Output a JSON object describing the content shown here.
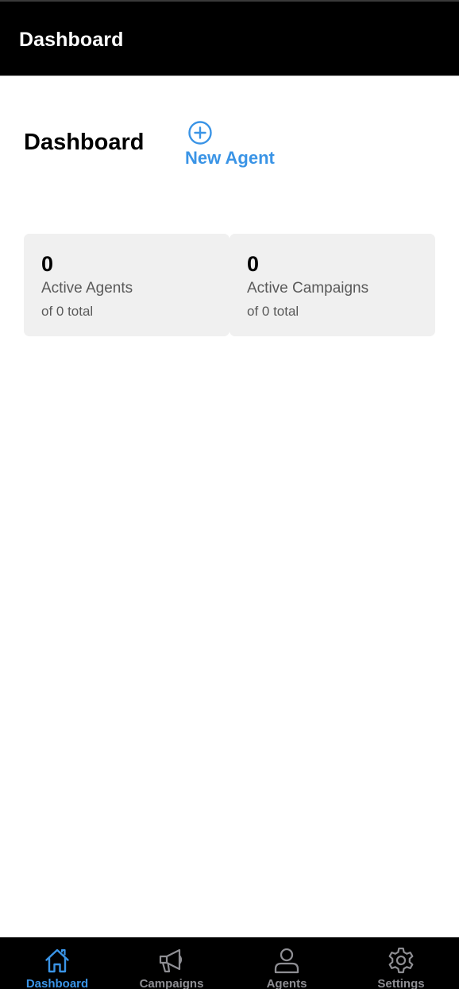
{
  "header": {
    "title": "Dashboard"
  },
  "main": {
    "heading": "Dashboard",
    "new_agent": {
      "label": "New Agent",
      "icon": "plus-circle-icon"
    },
    "stats": [
      {
        "count": "0",
        "label": "Active Agents",
        "sub": "of 0 total"
      },
      {
        "count": "0",
        "label": "Active Campaigns",
        "sub": "of 0 total"
      }
    ]
  },
  "tabs": [
    {
      "label": "Dashboard",
      "icon": "home-icon",
      "active": true
    },
    {
      "label": "Campaigns",
      "icon": "megaphone-icon",
      "active": false
    },
    {
      "label": "Agents",
      "icon": "person-icon",
      "active": false
    },
    {
      "label": "Settings",
      "icon": "gear-icon",
      "active": false
    }
  ],
  "colors": {
    "accent": "#3a94e6",
    "inactive": "#8e8e93",
    "bar_background": "#000000",
    "card_background": "#f0f0f0"
  }
}
